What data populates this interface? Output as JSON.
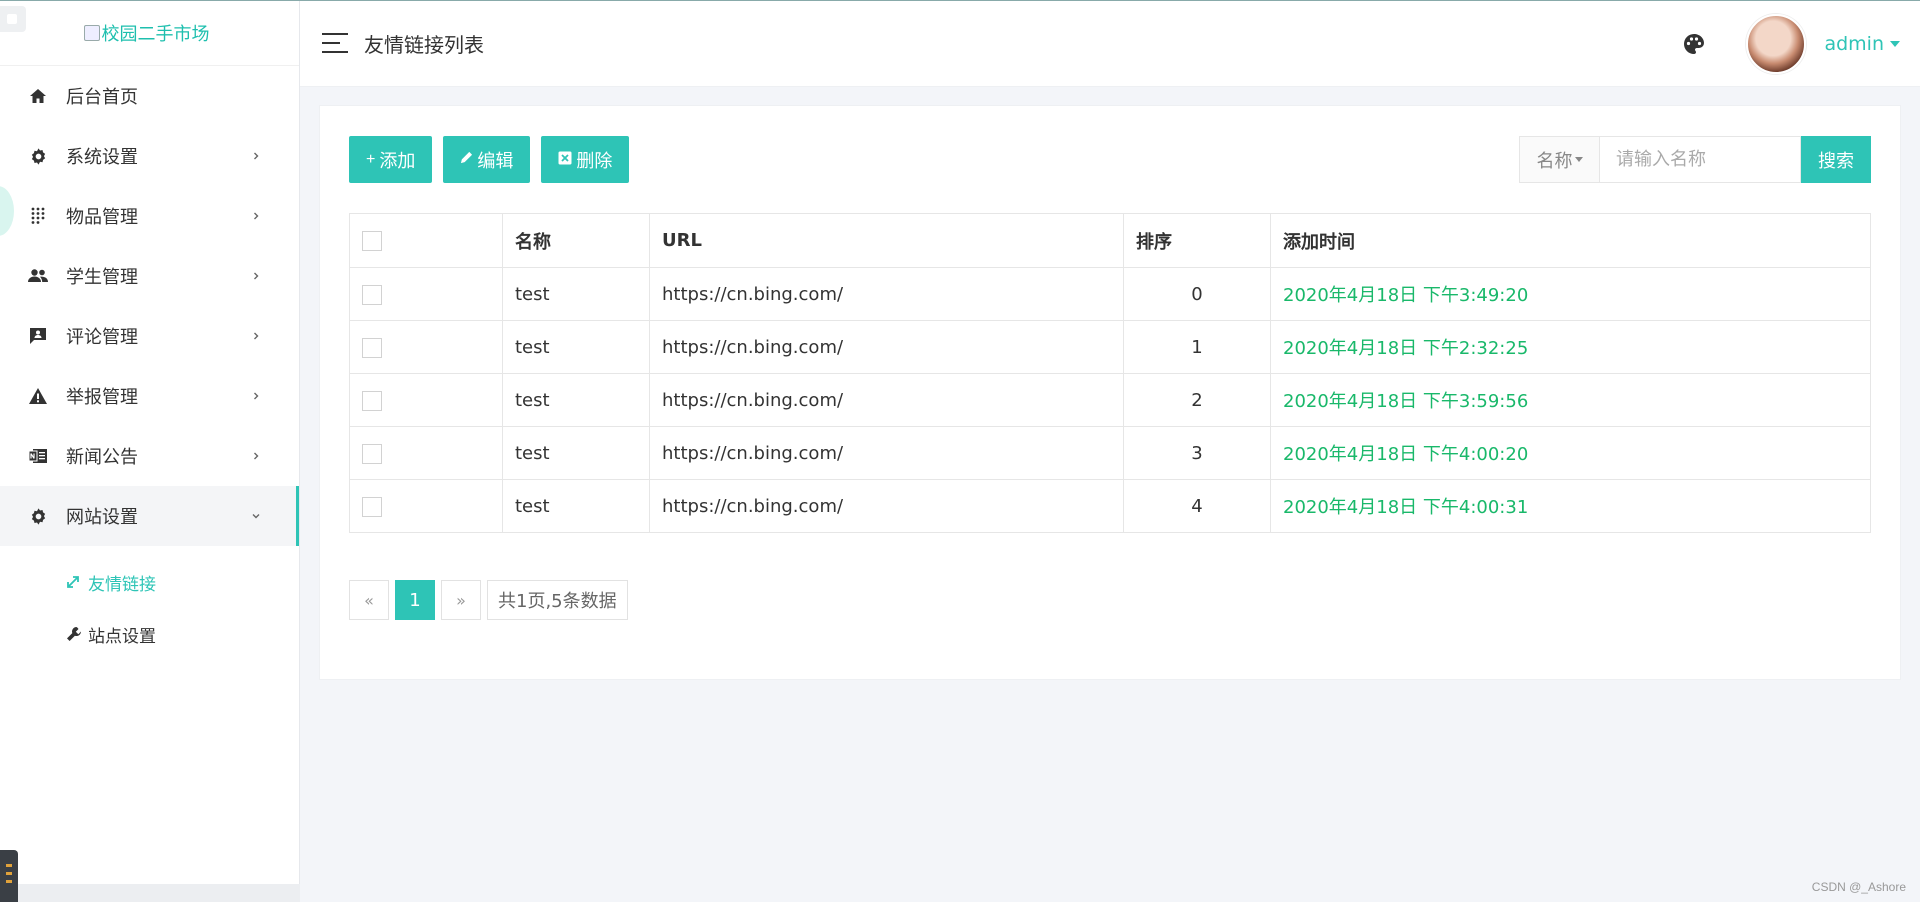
{
  "sidebar": {
    "logo_alt": "校园二手市场",
    "menu": [
      {
        "label": "后台首页",
        "icon": "home-icon"
      },
      {
        "label": "系统设置",
        "icon": "gear-icon"
      },
      {
        "label": "物品管理",
        "icon": "grid-icon"
      },
      {
        "label": "学生管理",
        "icon": "users-icon"
      },
      {
        "label": "评论管理",
        "icon": "comment-icon"
      },
      {
        "label": "举报管理",
        "icon": "warning-icon"
      },
      {
        "label": "新闻公告",
        "icon": "news-icon"
      },
      {
        "label": "网站设置",
        "icon": "gear-icon"
      }
    ],
    "submenu": [
      {
        "label": "友情链接",
        "icon": "link-icon",
        "active": true
      },
      {
        "label": "站点设置",
        "icon": "wrench-icon",
        "active": false
      }
    ]
  },
  "header": {
    "title": "友情链接列表",
    "user": "admin"
  },
  "toolbar": {
    "add_label": "添加",
    "edit_label": "编辑",
    "delete_label": "删除"
  },
  "search": {
    "field": "名称",
    "placeholder": "请输入名称",
    "button": "搜索"
  },
  "table": {
    "columns": [
      "名称",
      "URL",
      "排序",
      "添加时间"
    ],
    "rows": [
      {
        "name": "test",
        "url": "https://cn.bing.com/",
        "order": "0",
        "time": "2020年4月18日 下午3:49:20"
      },
      {
        "name": "test",
        "url": "https://cn.bing.com/",
        "order": "1",
        "time": "2020年4月18日 下午2:32:25"
      },
      {
        "name": "test",
        "url": "https://cn.bing.com/",
        "order": "2",
        "time": "2020年4月18日 下午3:59:56"
      },
      {
        "name": "test",
        "url": "https://cn.bing.com/",
        "order": "3",
        "time": "2020年4月18日 下午4:00:20"
      },
      {
        "name": "test",
        "url": "https://cn.bing.com/",
        "order": "4",
        "time": "2020年4月18日 下午4:00:31"
      }
    ]
  },
  "pagination": {
    "prev": "«",
    "current": "1",
    "next": "»",
    "info": "共1页,5条数据"
  },
  "watermark": "CSDN @_Ashore",
  "colors": {
    "accent": "#2ec4b6",
    "time_text": "#19b86a",
    "background": "#f3f5f9"
  }
}
